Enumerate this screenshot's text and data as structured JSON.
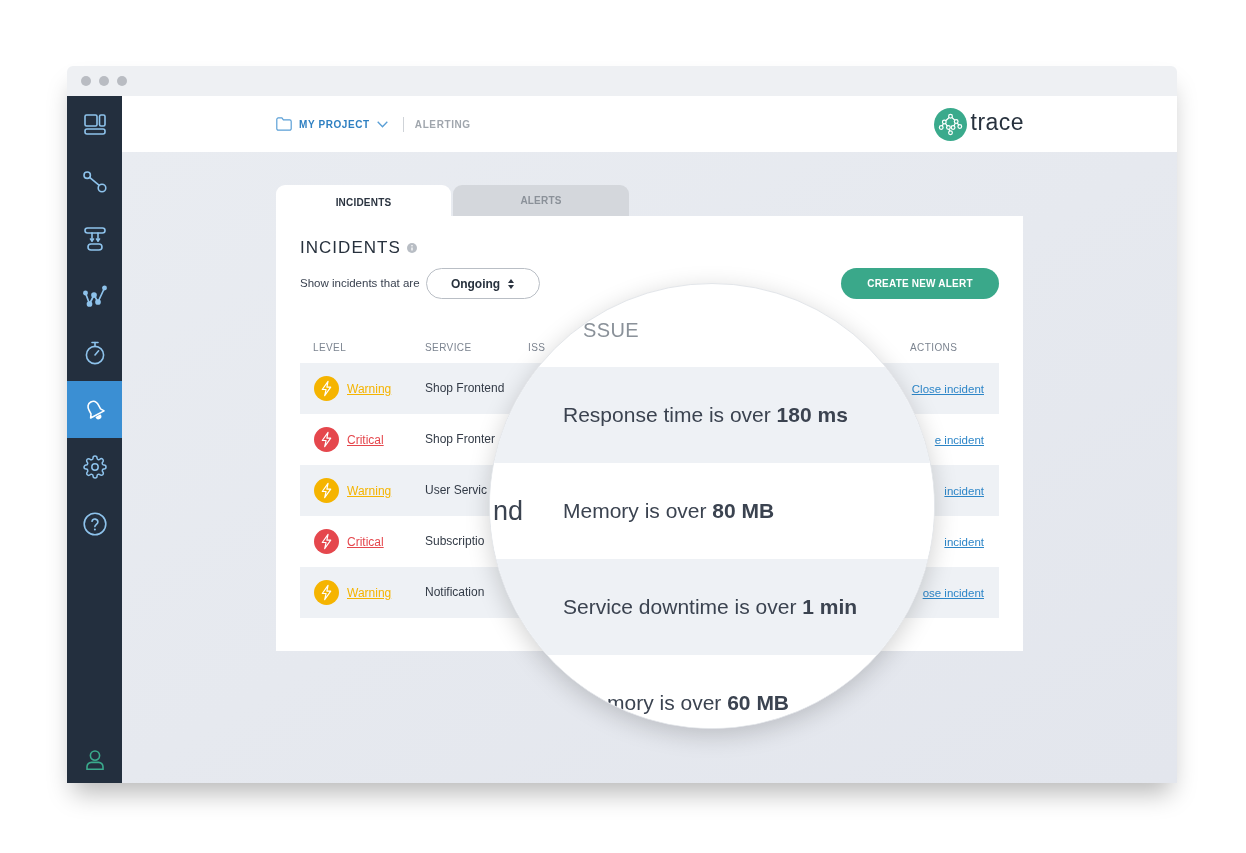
{
  "sidebar": {
    "items": [
      {
        "selected": false
      },
      {
        "selected": false
      },
      {
        "selected": false
      },
      {
        "selected": false
      },
      {
        "selected": false
      },
      {
        "selected": true
      },
      {
        "selected": false
      },
      {
        "selected": false
      }
    ]
  },
  "header": {
    "project": "MY PROJECT",
    "page": "ALERTING",
    "logo": "trace"
  },
  "tabs": [
    {
      "label": "INCIDENTS",
      "selected": true
    },
    {
      "label": "ALERTS",
      "selected": false
    }
  ],
  "panel": {
    "title": "INCIDENTS",
    "filter_label": "Show incidents that are",
    "filter_value": "Ongoing",
    "create_button": "CREATE NEW ALERT"
  },
  "table": {
    "columns": [
      "LEVEL",
      "SERVICE",
      "ISS",
      "ACTIONS"
    ],
    "rows": [
      {
        "level": "Warning",
        "color": "#f5b400",
        "service": "Shop Frontend",
        "action": "Close incident"
      },
      {
        "level": "Critical",
        "color": "#e5474d",
        "service": "Shop Fronter",
        "action": "e incident"
      },
      {
        "level": "Warning",
        "color": "#f5b400",
        "service": "User Servic",
        "action": "incident"
      },
      {
        "level": "Critical",
        "color": "#e5474d",
        "service": "Subscriptio",
        "action": "incident"
      },
      {
        "level": "Warning",
        "color": "#f5b400",
        "service": "Notification",
        "action": "ose incident"
      }
    ]
  },
  "magnifier": {
    "heading": "SSUE",
    "rows": [
      {
        "text": "Response time is over **180 ms**",
        "clipped": false
      },
      {
        "fragment": "nd",
        "text": "Memory is over **80 MB**",
        "clipped": false
      },
      {
        "text": "Service downtime is over **1 min**",
        "clipped": false
      },
      {
        "text": "mory is over **60 MB**",
        "clipped": true
      }
    ]
  }
}
